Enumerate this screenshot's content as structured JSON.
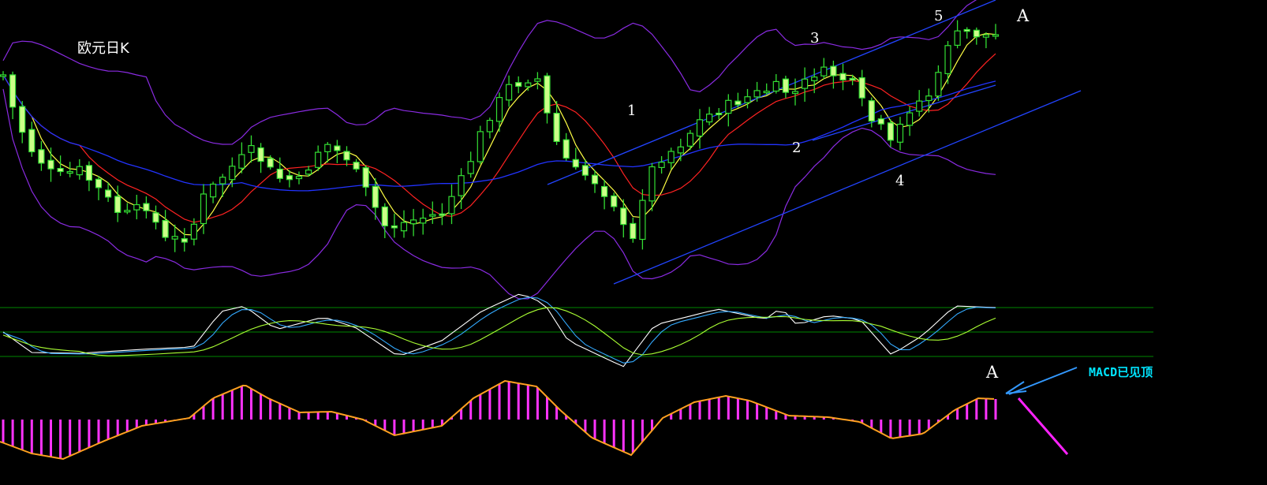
{
  "chart_data": {
    "type": "candlestick",
    "title": "欧元日K",
    "wave_labels": [
      "1",
      "2",
      "3",
      "4",
      "5",
      "A"
    ],
    "indicator_label_A": "A",
    "macd_note": "MACD已见顶",
    "colors": {
      "background": "#000000",
      "candle": "#33dd33",
      "candle_body_up": "#000000",
      "candle_body_down": "#ccff88",
      "ma_short": "#ffff44",
      "ma_mid": "#ff2222",
      "ma_long": "#2233ff",
      "bollinger": "#8a2be2",
      "trend_channel": "#2244ff",
      "kdj_k": "#ffffff",
      "kdj_d": "#33aaff",
      "kdj_slow": "#aaff33",
      "macd_hist": "#ff33ff",
      "macd_line": "#ffa020",
      "note_arrow": "#3399ff",
      "down_arrow": "#ff22ff",
      "grid": "#008800"
    },
    "series_description": "Daily EUR candlesticks, roughly 110 sessions, with short/mid/long moving averages, Bollinger bands, a rising trend channel, a KDJ oscillator panel and a MACD panel"
  }
}
